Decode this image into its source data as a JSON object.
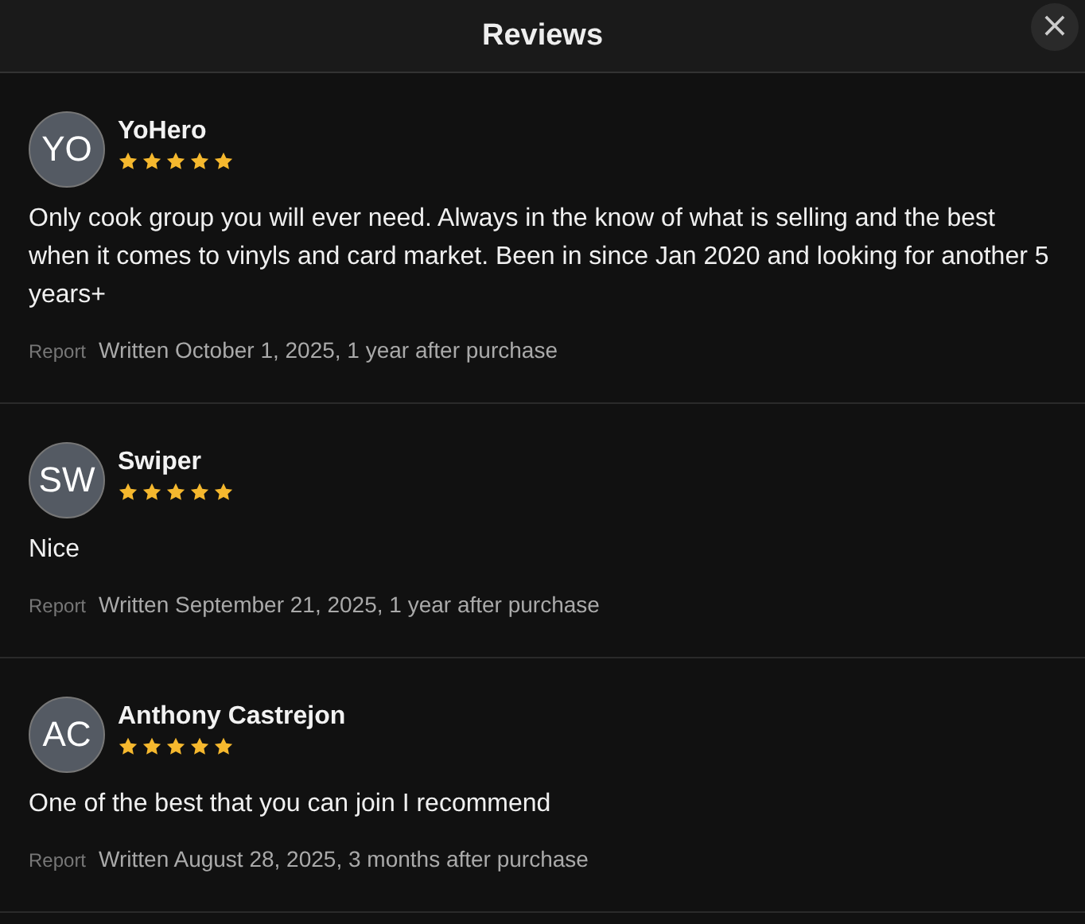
{
  "window": {
    "title": "Reviews",
    "close": "×"
  },
  "reviews": [
    {
      "initials": "YO",
      "name": "YoHero",
      "stars": 5,
      "text": "Only cook group you will ever need. Always in the know of what is selling and the best when it comes to vinyls and card market. Been in since Jan 2020 and looking for another 5 years+",
      "report": "Report",
      "written": "Written October 1, 2025, 1 year after purchase"
    },
    {
      "initials": "SW",
      "name": "Swiper",
      "stars": 5,
      "text": "Nice",
      "report": "Report",
      "written": "Written September 21, 2025, 1 year after purchase"
    },
    {
      "initials": "AC",
      "name": "Anthony Castrejon",
      "stars": 5,
      "text": "One of the best that you can join I recommend",
      "report": "Report",
      "written": "Written August 28, 2025, 3 months after purchase"
    }
  ]
}
